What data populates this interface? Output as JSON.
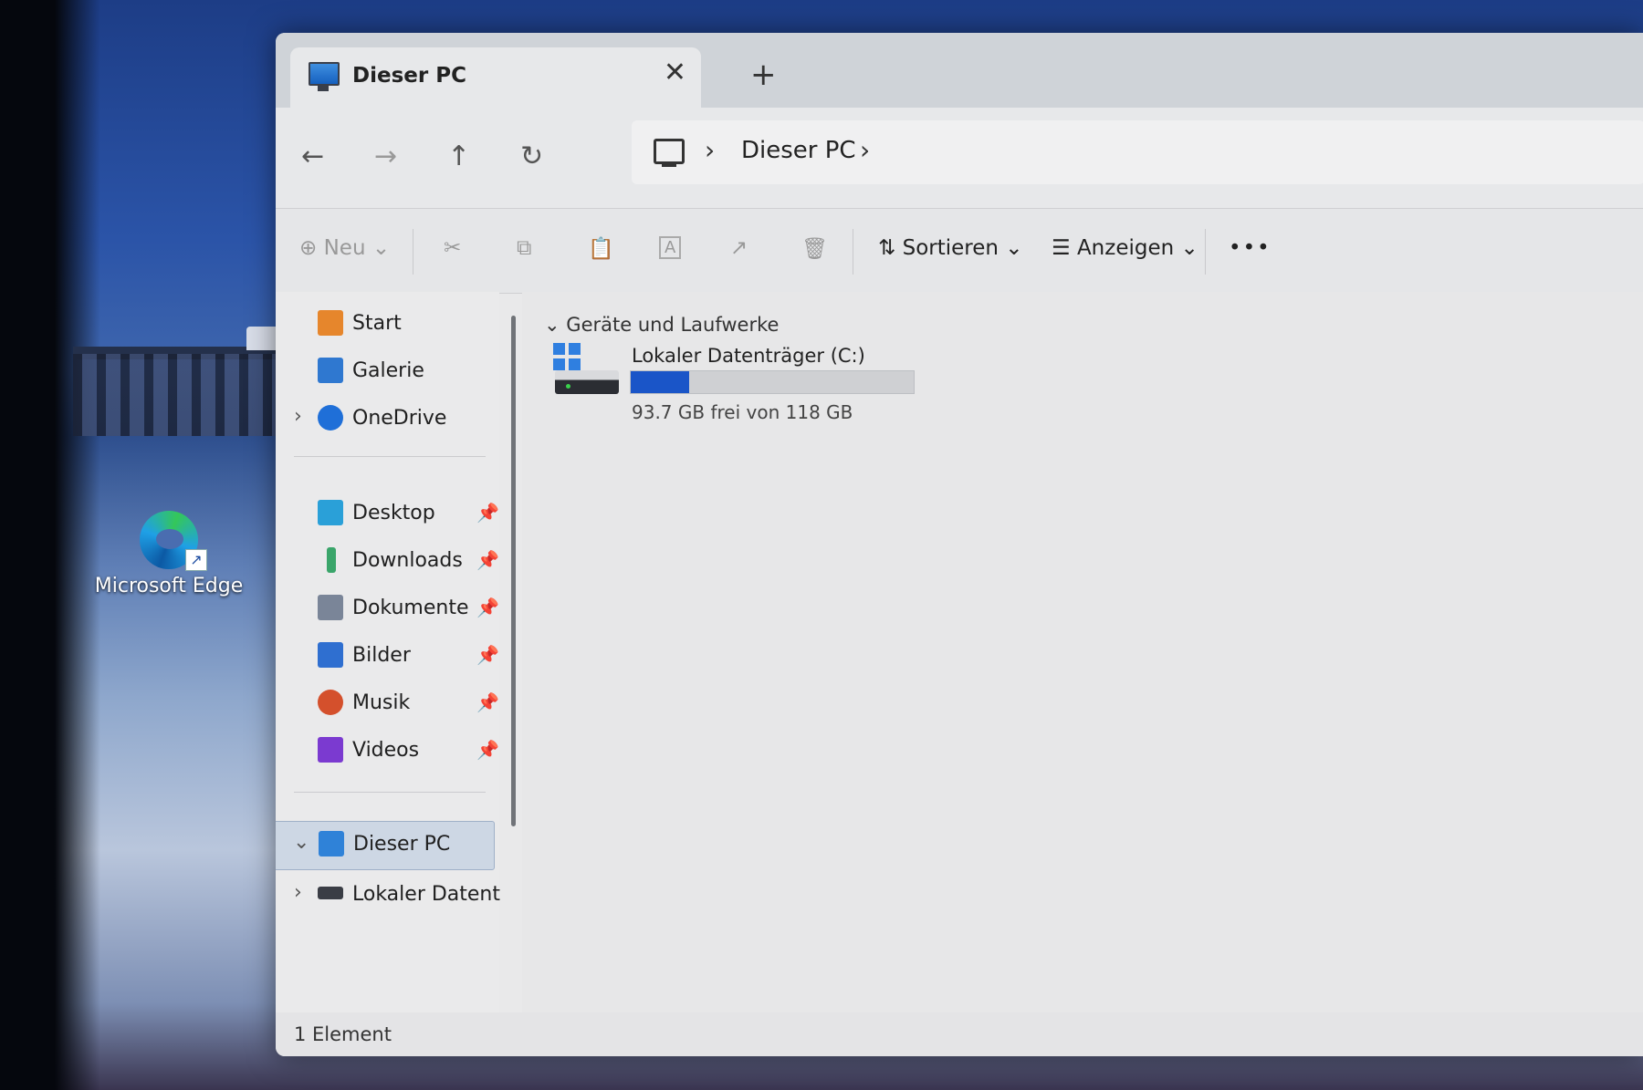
{
  "desktop": {
    "shortcut_label": "Microsoft Edge"
  },
  "window": {
    "tab": {
      "title": "Dieser PC",
      "close": "✕",
      "new_tab": "+"
    },
    "nav": {
      "back": "←",
      "forward": "→",
      "up": "↑",
      "refresh": "↻"
    },
    "address": {
      "separator_1": "›",
      "current": "Dieser PC",
      "separator_2": "›"
    },
    "toolbar": {
      "new_label": "Neu",
      "sort_label": "Sortieren",
      "view_label": "Anzeigen",
      "more": "•••",
      "cut": "✂",
      "copy": "⧉",
      "paste": "📋",
      "rename": "A",
      "share": "↗",
      "delete": "🗑"
    },
    "sidebar": {
      "items": [
        {
          "label": "Start"
        },
        {
          "label": "Galerie"
        },
        {
          "label": "OneDrive"
        },
        {
          "label": "Desktop"
        },
        {
          "label": "Downloads"
        },
        {
          "label": "Dokumente"
        },
        {
          "label": "Bilder"
        },
        {
          "label": "Musik"
        },
        {
          "label": "Videos"
        },
        {
          "label": "Dieser PC"
        },
        {
          "label": "Lokaler Datent"
        }
      ],
      "pin": "📌",
      "chevron_right": "›",
      "chevron_down": "⌄"
    },
    "content": {
      "group_label": "Geräte und Laufwerke",
      "group_chevron": "⌄",
      "drive": {
        "name": "Lokaler Datenträger (C:)",
        "free_text": "93.7 GB frei von 118 GB",
        "used_fraction": 0.206
      }
    },
    "status": {
      "text": "1 Element"
    }
  },
  "colors": {
    "accent": "#1a55c8",
    "selected_bg": "#cdd7e4"
  }
}
